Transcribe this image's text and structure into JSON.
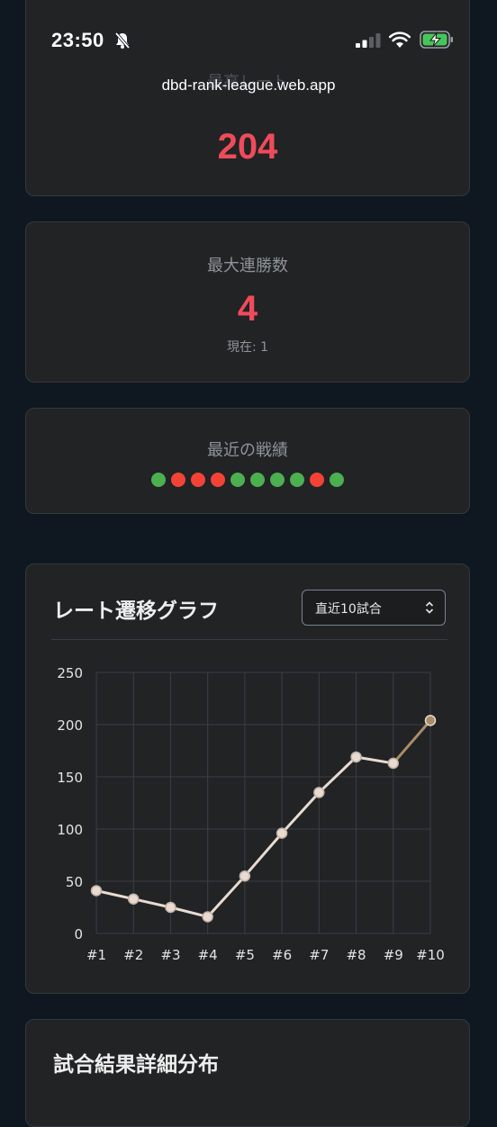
{
  "status_bar": {
    "time": "23:50",
    "url": "dbd-rank-league.web.app"
  },
  "stats": {
    "top_rate": {
      "label": "最高レート",
      "value": "204"
    },
    "max_streak": {
      "label": "最大連勝数",
      "value": "4",
      "current": "現在: 1"
    },
    "recent": {
      "label": "最近の戦績",
      "results": [
        "win",
        "loss",
        "loss",
        "loss",
        "win",
        "win",
        "win",
        "win",
        "loss",
        "win"
      ],
      "colors": {
        "win": "#4caf50",
        "loss": "#f44336"
      }
    }
  },
  "chart_section": {
    "title": "レート遷移グラフ",
    "range_select": {
      "selected": "直近10試合"
    }
  },
  "chart_data": {
    "type": "line",
    "categories": [
      "#1",
      "#2",
      "#3",
      "#4",
      "#5",
      "#6",
      "#7",
      "#8",
      "#9",
      "#10"
    ],
    "series": [
      {
        "values": [
          41,
          33,
          25,
          16,
          55,
          96,
          135,
          169,
          163,
          204
        ]
      }
    ],
    "ylim": [
      0,
      250
    ],
    "yticks": [
      0,
      50,
      100,
      150,
      200,
      250
    ],
    "grid": true,
    "colors": {
      "line": "#e9dbd0",
      "last_segment": "#a98d68",
      "point": "#e9dbd0",
      "last_point": "#a98d68"
    }
  },
  "distribution_section": {
    "title": "試合結果詳細分布"
  }
}
